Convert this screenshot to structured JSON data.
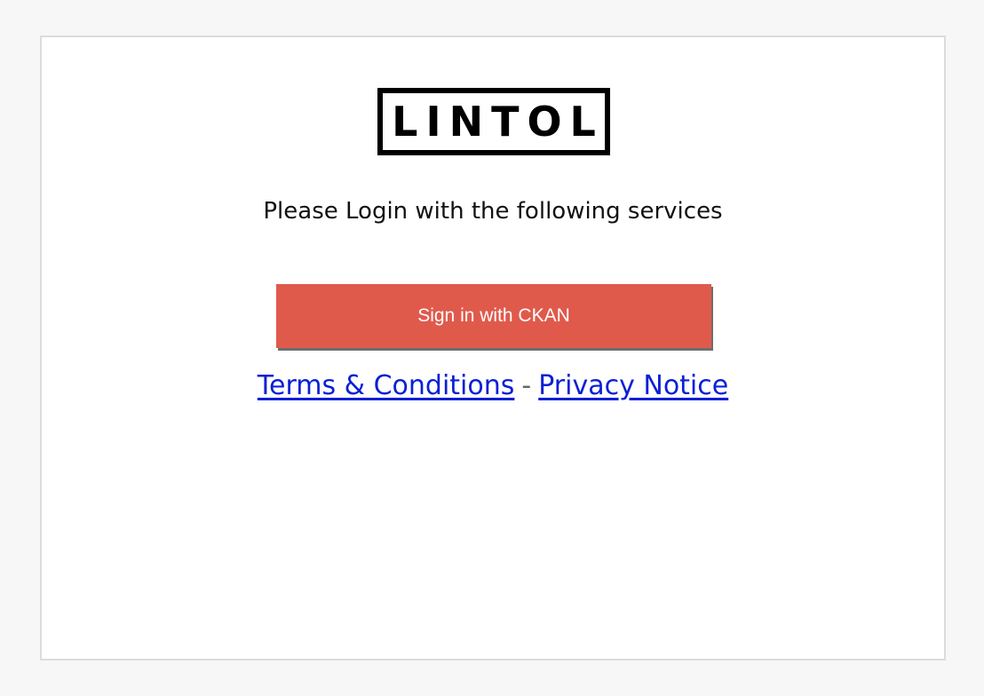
{
  "brand": {
    "logo_text": "LINTOL"
  },
  "login": {
    "prompt": "Please Login with the following services",
    "ckan_button_label": "Sign in with CKAN"
  },
  "footer_links": {
    "terms_label": "Terms & Conditions",
    "separator": "-",
    "privacy_label": "Privacy Notice"
  },
  "colors": {
    "page_background": "#f7f7f7",
    "button_background": "#e05a4c",
    "link_color": "#0a1fd6"
  }
}
